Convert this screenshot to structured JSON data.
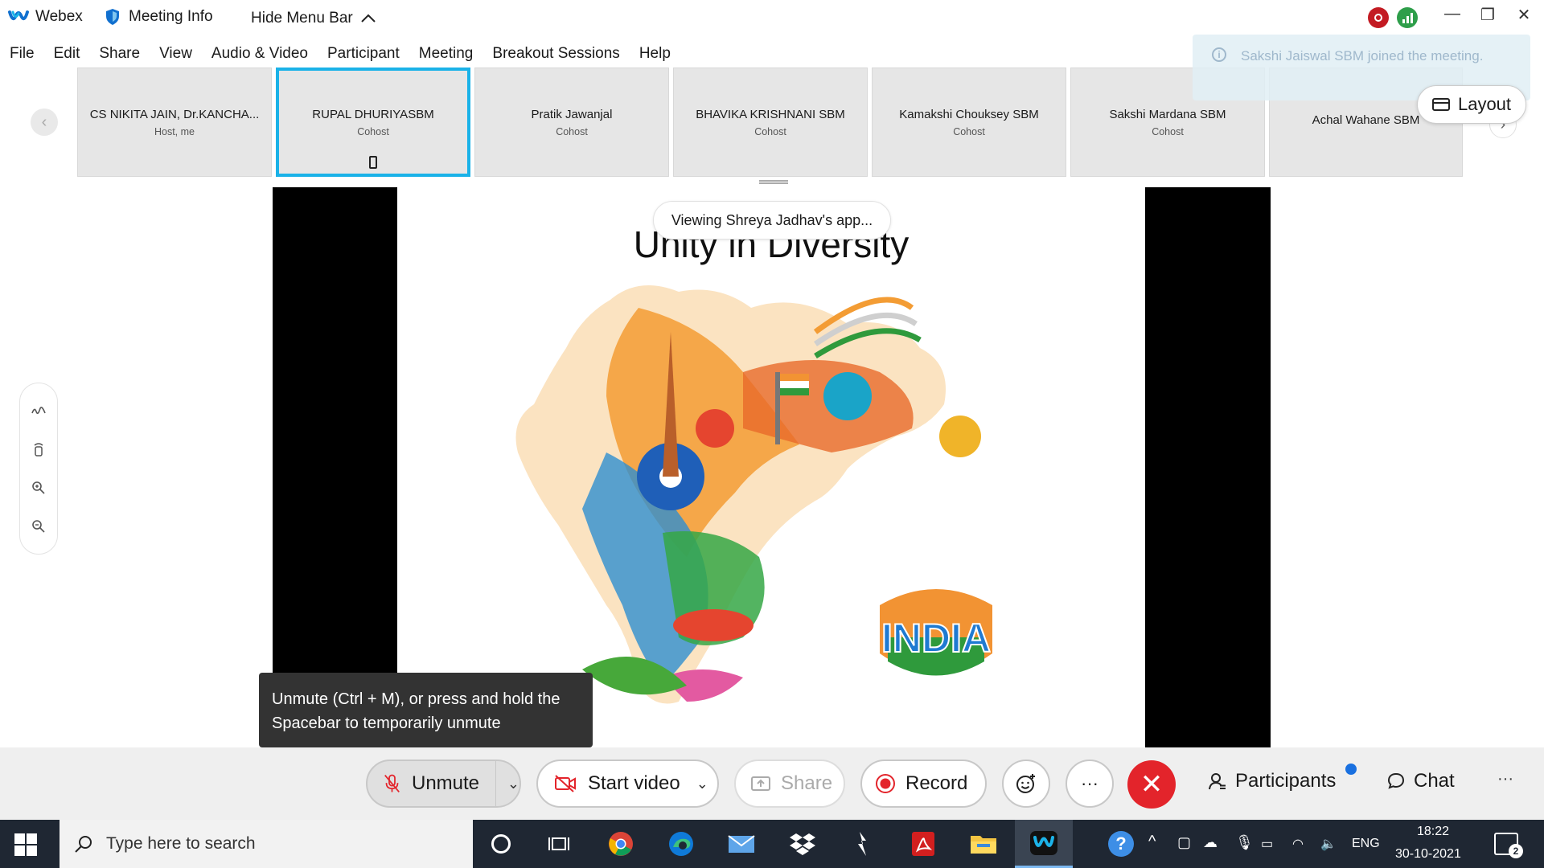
{
  "titlebar": {
    "app_name": "Webex",
    "meeting_info": "Meeting Info",
    "hide_menu": "Hide Menu Bar"
  },
  "menu": [
    "File",
    "Edit",
    "Share",
    "View",
    "Audio & Video",
    "Participant",
    "Meeting",
    "Breakout Sessions",
    "Help"
  ],
  "participants": [
    {
      "name": "CS NIKITA JAIN, Dr.KANCHA...",
      "role": "Host, me"
    },
    {
      "name": "RUPAL DHURIYASBM",
      "role": "Cohost"
    },
    {
      "name": "Pratik Jawanjal",
      "role": "Cohost"
    },
    {
      "name": "BHAVIKA KRISHNANI SBM",
      "role": "Cohost"
    },
    {
      "name": "Kamakshi Chouksey SBM",
      "role": "Cohost"
    },
    {
      "name": "Sakshi Mardana SBM",
      "role": "Cohost"
    },
    {
      "name": "Achal Wahane SBM",
      "role": ""
    }
  ],
  "toast": {
    "text": "Sakshi Jaiswal SBM joined the meeting."
  },
  "layout_label": "Layout",
  "share": {
    "viewing": "Viewing Shreya Jadhav's app...",
    "slide_title": "Unity in Diversity",
    "india_text": "INDIA"
  },
  "tooltip": "Unmute (Ctrl + M), or press and hold the Spacebar to temporarily unmute",
  "controls": {
    "unmute": "Unmute",
    "start_video": "Start video",
    "share": "Share",
    "record": "Record",
    "participants": "Participants",
    "chat": "Chat"
  },
  "taskbar": {
    "search_placeholder": "Type here to search",
    "lang": "ENG",
    "time": "18:22",
    "date": "30-10-2021",
    "notif_count": "2"
  },
  "colors": {
    "accent_active": "#1ab2e8",
    "end_red": "#e3242b",
    "notification_dot": "#1970e0"
  }
}
